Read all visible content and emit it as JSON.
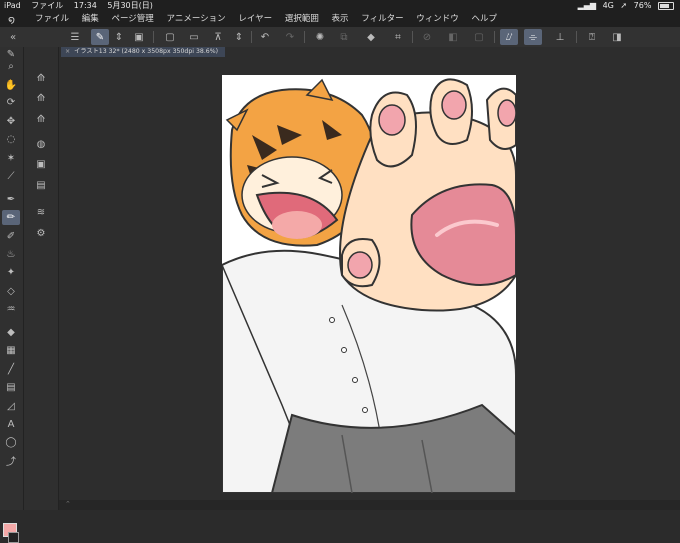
{
  "status_bar": {
    "ipad": "iPad",
    "app": "ファイル",
    "time": "17:34",
    "date": "5月30日(日)",
    "signal": "4G",
    "battery": "76%"
  },
  "menu": [
    "ファイル",
    "編集",
    "ページ管理",
    "アニメーション",
    "レイヤー",
    "選択範囲",
    "表示",
    "フィルター",
    "ウィンドウ",
    "ヘルプ"
  ],
  "document": {
    "tab_label": "イラスト13 32* (2480 x 3508px 350dpi 38.6%)"
  },
  "tools": [
    "zoom-icon",
    "hand-icon",
    "rotate-icon",
    "move-icon",
    "lasso-select-icon",
    "magic-wand-icon",
    "eyedropper-icon",
    "pen-icon",
    "pencil-icon",
    "brush-icon",
    "airbrush-icon",
    "decoration-icon",
    "eraser-icon",
    "blend-icon",
    "fill-icon",
    "gradient-icon",
    "line-icon",
    "frame-icon",
    "ruler-icon",
    "text-icon",
    "balloon-icon",
    "correct-line-icon"
  ],
  "colors": {
    "main_color": "#f4a9a8",
    "sub_color": "#222222",
    "accent": "#5a6578"
  }
}
